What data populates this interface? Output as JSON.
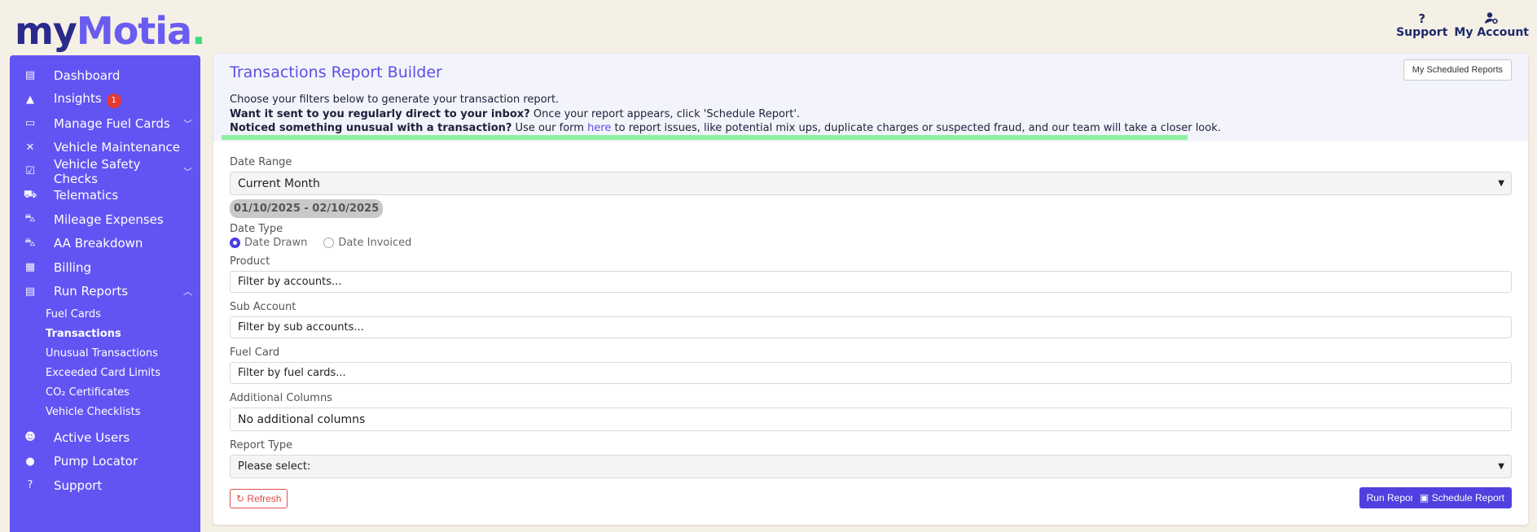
{
  "brand": {
    "logo_my": "my",
    "logo_motia": "Motia",
    "logo_dot": "."
  },
  "header": {
    "support_icon": "?",
    "support_label": "Support",
    "account_icon": "user-gear-icon",
    "account_label": "My Account"
  },
  "sidebar": {
    "items": [
      {
        "label": "Dashboard",
        "icon": "dashboard-icon",
        "glyph": "▤"
      },
      {
        "label": "Insights",
        "icon": "warning-icon",
        "glyph": "▲",
        "badge": "1"
      },
      {
        "label": "Manage Fuel Cards",
        "icon": "card-icon",
        "glyph": "▭",
        "chevron": "﹀"
      },
      {
        "label": "Vehicle Maintenance",
        "icon": "tools-icon",
        "glyph": "✕"
      },
      {
        "label": "Vehicle Safety Checks",
        "icon": "clipboard-check-icon",
        "glyph": "☑",
        "chevron": "﹀"
      },
      {
        "label": "Telematics",
        "icon": "truck-icon",
        "glyph": "⛟"
      },
      {
        "label": "Mileage Expenses",
        "icon": "car-icon",
        "glyph": "⛍"
      },
      {
        "label": "AA Breakdown",
        "icon": "car-crash-icon",
        "glyph": "⛍"
      },
      {
        "label": "Billing",
        "icon": "building-icon",
        "glyph": "▦"
      },
      {
        "label": "Run Reports",
        "icon": "report-icon",
        "glyph": "▤",
        "chevron": "︿"
      }
    ],
    "subitems": [
      {
        "label": "Fuel Cards"
      },
      {
        "label": "Transactions"
      },
      {
        "label": "Unusual Transactions"
      },
      {
        "label": "Exceeded Card Limits"
      },
      {
        "label": "CO₂ Certificates"
      },
      {
        "label": "Vehicle Checklists"
      }
    ],
    "bottom_items": [
      {
        "label": "Active Users",
        "icon": "users-icon",
        "glyph": "☻"
      },
      {
        "label": "Pump Locator",
        "icon": "map-pin-icon",
        "glyph": "●"
      },
      {
        "label": "Support",
        "icon": "question-icon",
        "glyph": "?"
      }
    ]
  },
  "main": {
    "title": "Transactions Report Builder",
    "scheduled_reports_button": "My Scheduled Reports",
    "intro_line1": "Choose your filters below to generate your transaction report.",
    "intro_line2_bold": "Want it sent to you regularly direct to your inbox?",
    "intro_line2_rest": " Once your report appears, click 'Schedule Report'.",
    "intro_line3_bold": "Noticed something unusual with a transaction?",
    "intro_line3_pre": " Use our form ",
    "intro_line3_link": "here",
    "intro_line3_post": " to report issues, like potential mix ups, duplicate charges or suspected fraud, and our team will take a closer look."
  },
  "form": {
    "date_range_label": "Date Range",
    "date_range_value": "Current Month",
    "date_range_display": "01/10/2025 - 02/10/2025",
    "date_type_label": "Date Type",
    "date_type_options": [
      "Date Drawn",
      "Date Invoiced"
    ],
    "date_type_selected": "Date Drawn",
    "product_label": "Product",
    "product_placeholder": "Filter by accounts...",
    "sub_account_label": "Sub Account",
    "sub_account_placeholder": "Filter by sub accounts...",
    "fuel_card_label": "Fuel Card",
    "fuel_card_placeholder": "Filter by fuel cards...",
    "additional_columns_label": "Additional Columns",
    "additional_columns_value": "No additional columns",
    "report_type_label": "Report Type",
    "report_type_value": "Please select:"
  },
  "actions": {
    "refresh_label": "Refresh",
    "run_report_label": "Run Report",
    "schedule_report_label": "Schedule Report"
  },
  "colors": {
    "sidebar": "#6254f3",
    "accent": "#5b4fe6",
    "primary_button": "#5040e0",
    "danger": "#e04b4b",
    "highlight": "#8ef0a2",
    "background": "#f5f0e6"
  }
}
